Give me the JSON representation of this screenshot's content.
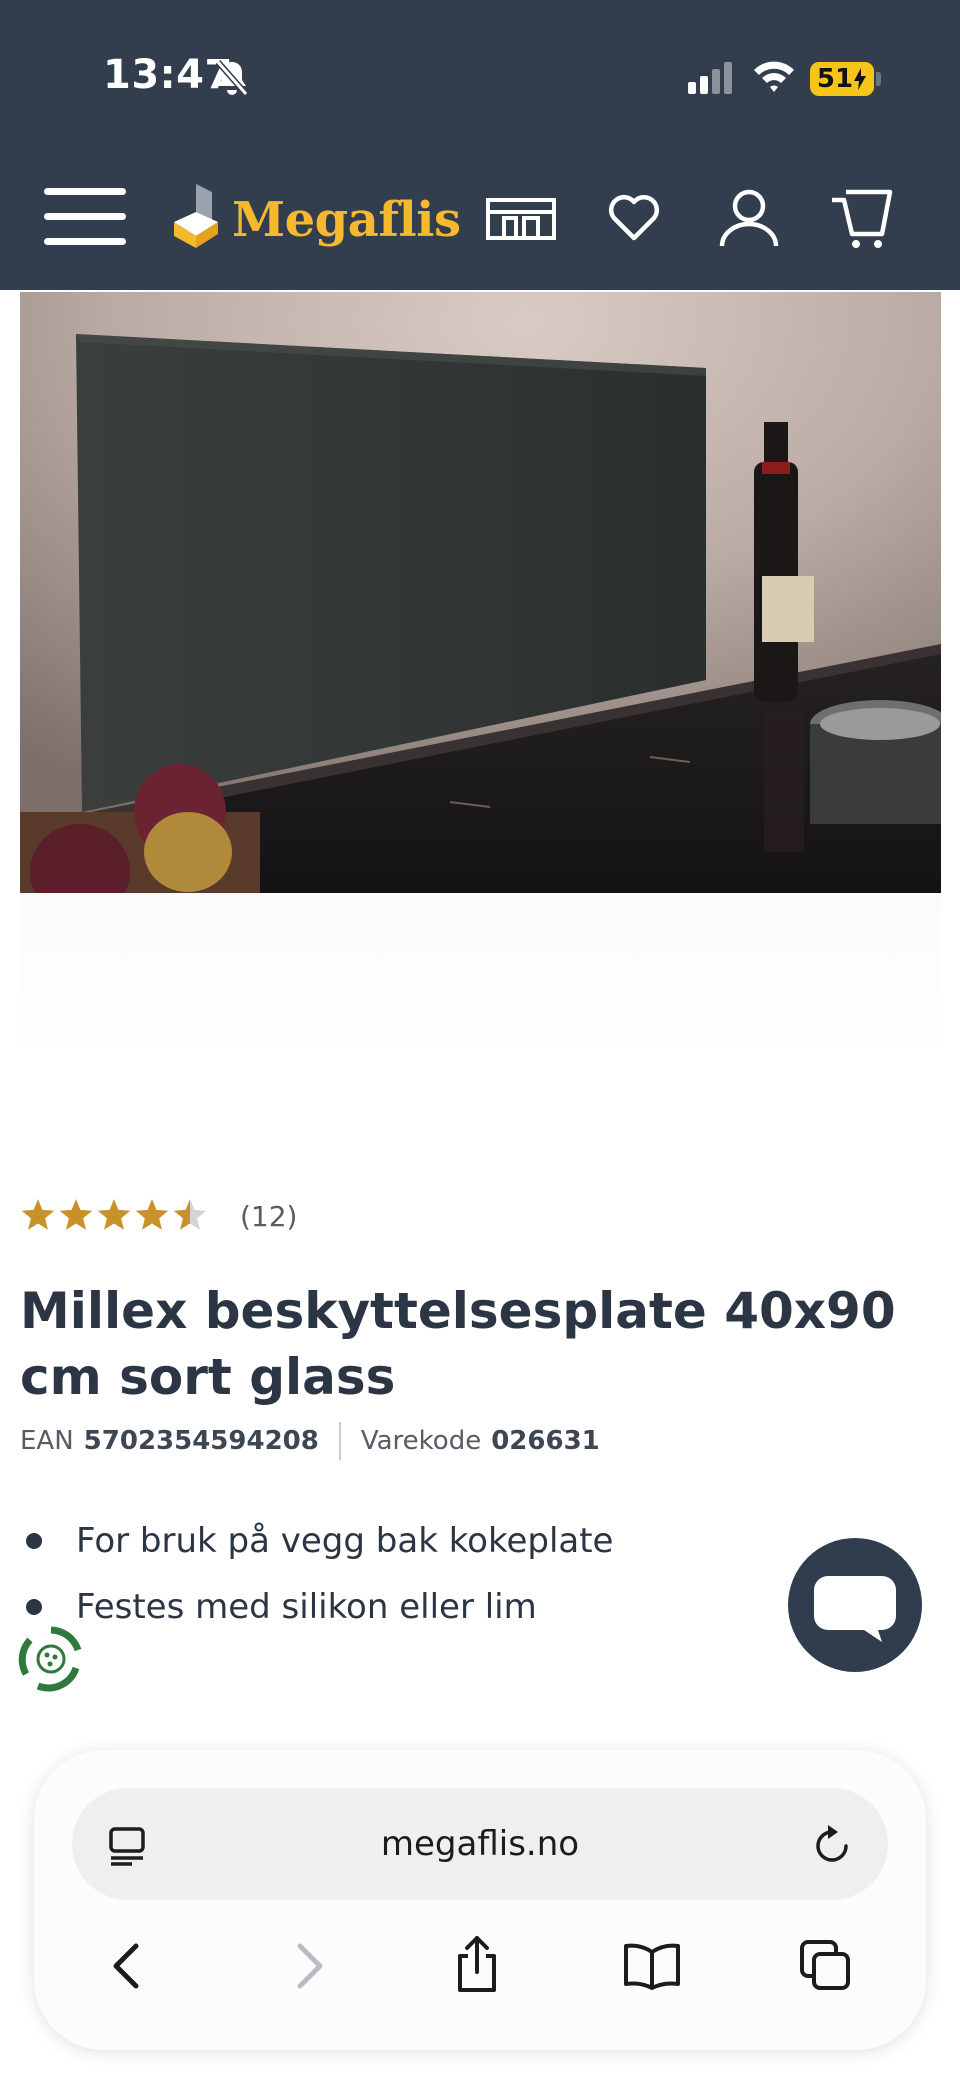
{
  "status_bar": {
    "time": "13:47",
    "battery": "51",
    "icons": [
      "bell-off-icon",
      "signal-icon",
      "wifi-icon",
      "battery-charging-icon"
    ]
  },
  "header": {
    "brand": "Megaflis",
    "icons": [
      "menu-icon",
      "store-icon",
      "heart-icon",
      "user-icon",
      "cart-icon"
    ],
    "colors": {
      "background": "#323d4d",
      "brand": "#f5b92e"
    }
  },
  "product": {
    "rating": 4.5,
    "rating_max": 5,
    "review_count": "(12)",
    "title": "Millex beskyttelsesplate 40x90 cm sort glass",
    "ean_label": "EAN",
    "ean": "5702354594208",
    "sku_label": "Varekode",
    "sku": "026631",
    "bullets": [
      "For bruk på vegg bak kokeplate",
      "Festes med silikon eller lim"
    ],
    "star_color": "#c8922a"
  },
  "chat": {
    "icon": "chat-bubble-icon"
  },
  "browser": {
    "url": "megaflis.no",
    "icons": [
      "reader-icon",
      "reload-icon",
      "back-icon",
      "forward-icon",
      "share-icon",
      "bookmarks-icon",
      "tabs-icon"
    ]
  }
}
